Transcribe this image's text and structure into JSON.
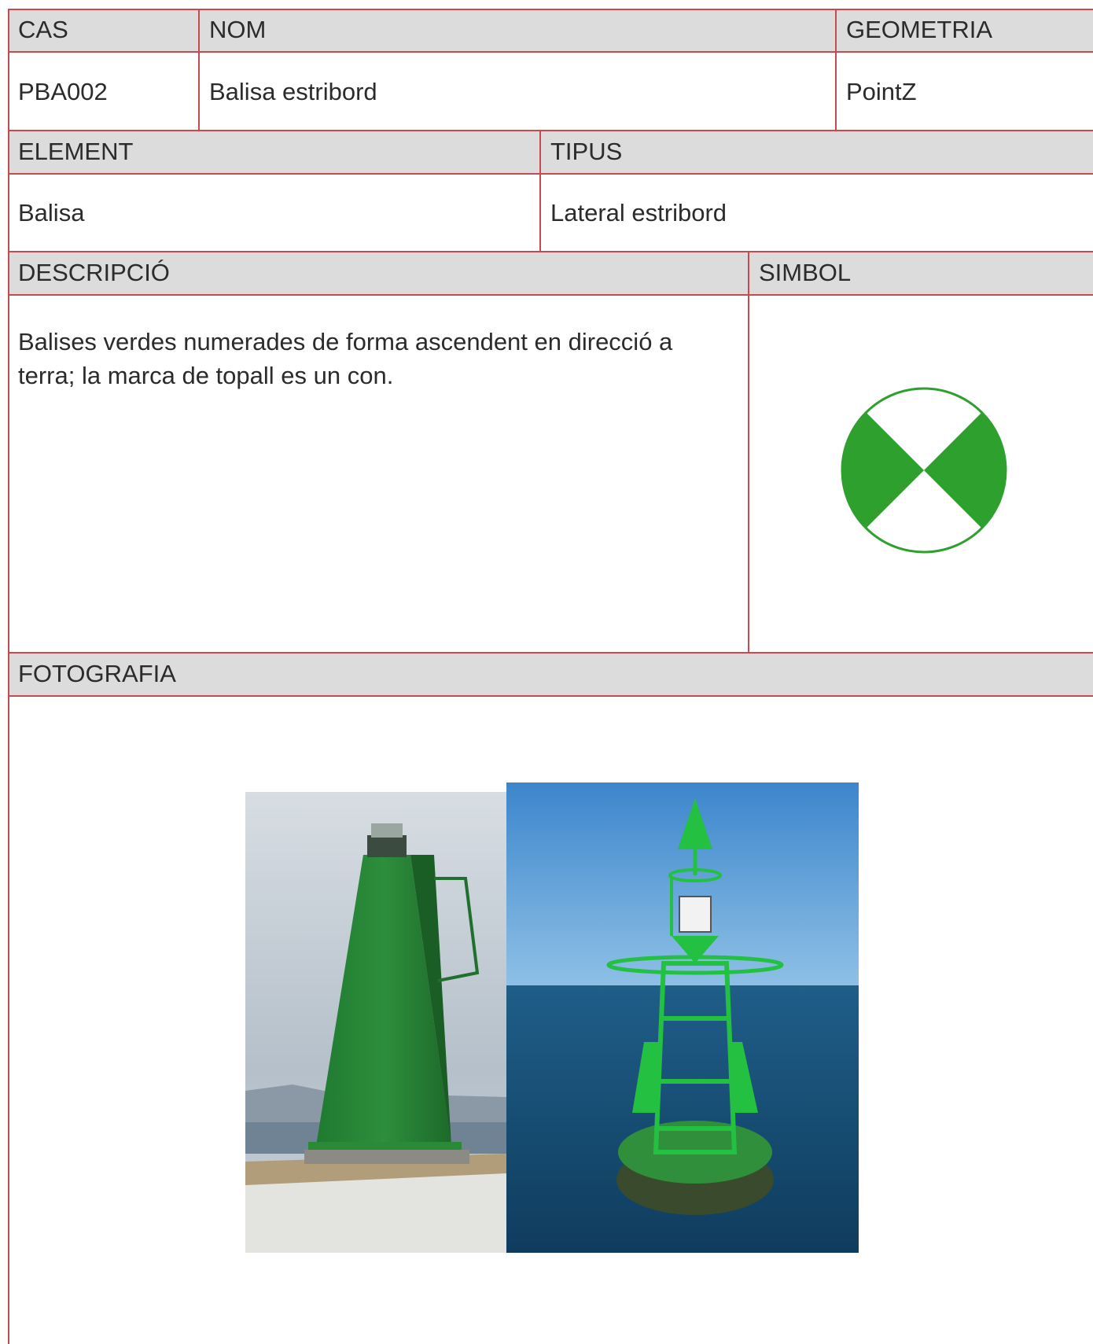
{
  "row1": {
    "cas_header": "CAS",
    "nom_header": "NOM",
    "geometria_header": "GEOMETRIA",
    "cas_value": "PBA002",
    "nom_value": "Balisa estribord",
    "geometria_value": "PointZ"
  },
  "row2": {
    "element_header": "ELEMENT",
    "tipus_header": "TIPUS",
    "element_value": "Balisa",
    "tipus_value": "Lateral estribord"
  },
  "row3": {
    "descripcio_header": "DESCRIPCIÓ",
    "simbol_header": "SIMBOL",
    "descripcio_value": "Balises verdes numerades de forma ascendent en direcció a terra; la marca de topall es un con."
  },
  "row4": {
    "fotografia_header": "FOTOGRAFIA"
  },
  "colors": {
    "border": "#c8494f",
    "header_bg": "#dcdcdc",
    "symbol_green": "#2ea02e"
  },
  "photos": [
    {
      "subject": "green tower beacon on a breakwater"
    },
    {
      "subject": "green floating buoy with cone topmark at sea"
    }
  ]
}
